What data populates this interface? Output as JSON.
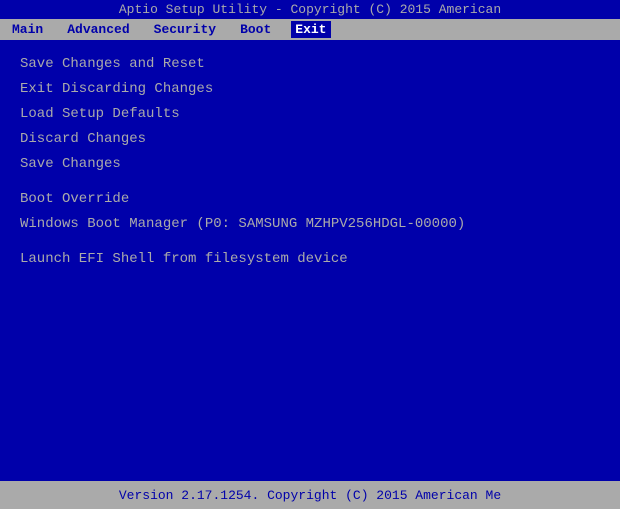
{
  "title_bar": {
    "text": "Aptio Setup Utility - Copyright (C) 2015 American"
  },
  "menu_bar": {
    "items": [
      {
        "label": "Main",
        "active": false
      },
      {
        "label": "Advanced",
        "active": false
      },
      {
        "label": "Security",
        "active": false
      },
      {
        "label": "Boot",
        "active": false
      },
      {
        "label": "Exit",
        "active": true
      }
    ]
  },
  "content": {
    "options": [
      {
        "id": "save-changes-reset",
        "text": "Save Changes and Reset"
      },
      {
        "id": "exit-discarding",
        "text": "Exit Discarding Changes"
      },
      {
        "id": "load-setup-defaults",
        "text": "Load Setup Defaults"
      },
      {
        "id": "discard-changes",
        "text": "Discard Changes"
      },
      {
        "id": "save-changes",
        "text": "Save Changes"
      }
    ],
    "boot_override_label": "Boot Override",
    "boot_override_item": "Windows Boot Manager (P0: SAMSUNG MZHPV256HDGL-00000)",
    "launch_efi": "Launch EFI Shell from filesystem device"
  },
  "footer": {
    "text": "Version 2.17.1254. Copyright (C) 2015 American Me"
  }
}
